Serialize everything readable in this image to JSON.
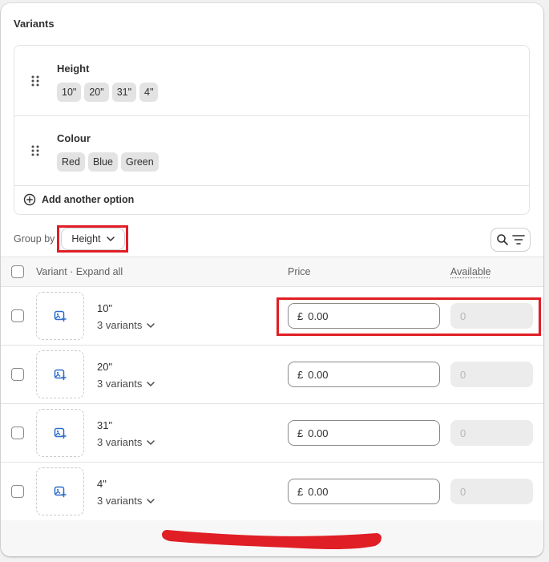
{
  "card": {
    "title": "Variants"
  },
  "options": [
    {
      "name": "Height",
      "values": [
        "10\"",
        "20\"",
        "31\"",
        "4\""
      ]
    },
    {
      "name": "Colour",
      "values": [
        "Red",
        "Blue",
        "Green"
      ]
    }
  ],
  "add_option_label": "Add another option",
  "group_by": {
    "label": "Group by",
    "value": "Height"
  },
  "table": {
    "header_variant": "Variant · Expand all",
    "header_price": "Price",
    "header_available": "Available",
    "rows": [
      {
        "name": "10\"",
        "count": "3 variants",
        "currency": "£",
        "price": "0.00",
        "available": "0"
      },
      {
        "name": "20\"",
        "count": "3 variants",
        "currency": "£",
        "price": "0.00",
        "available": "0"
      },
      {
        "name": "31\"",
        "count": "3 variants",
        "currency": "£",
        "price": "0.00",
        "available": "0"
      },
      {
        "name": "4\"",
        "count": "3 variants",
        "currency": "£",
        "price": "0.00",
        "available": "0"
      }
    ]
  },
  "colors": {
    "highlight": "#e01e25",
    "image_icon": "#2c6ecb",
    "annotation": "#e01e25"
  }
}
